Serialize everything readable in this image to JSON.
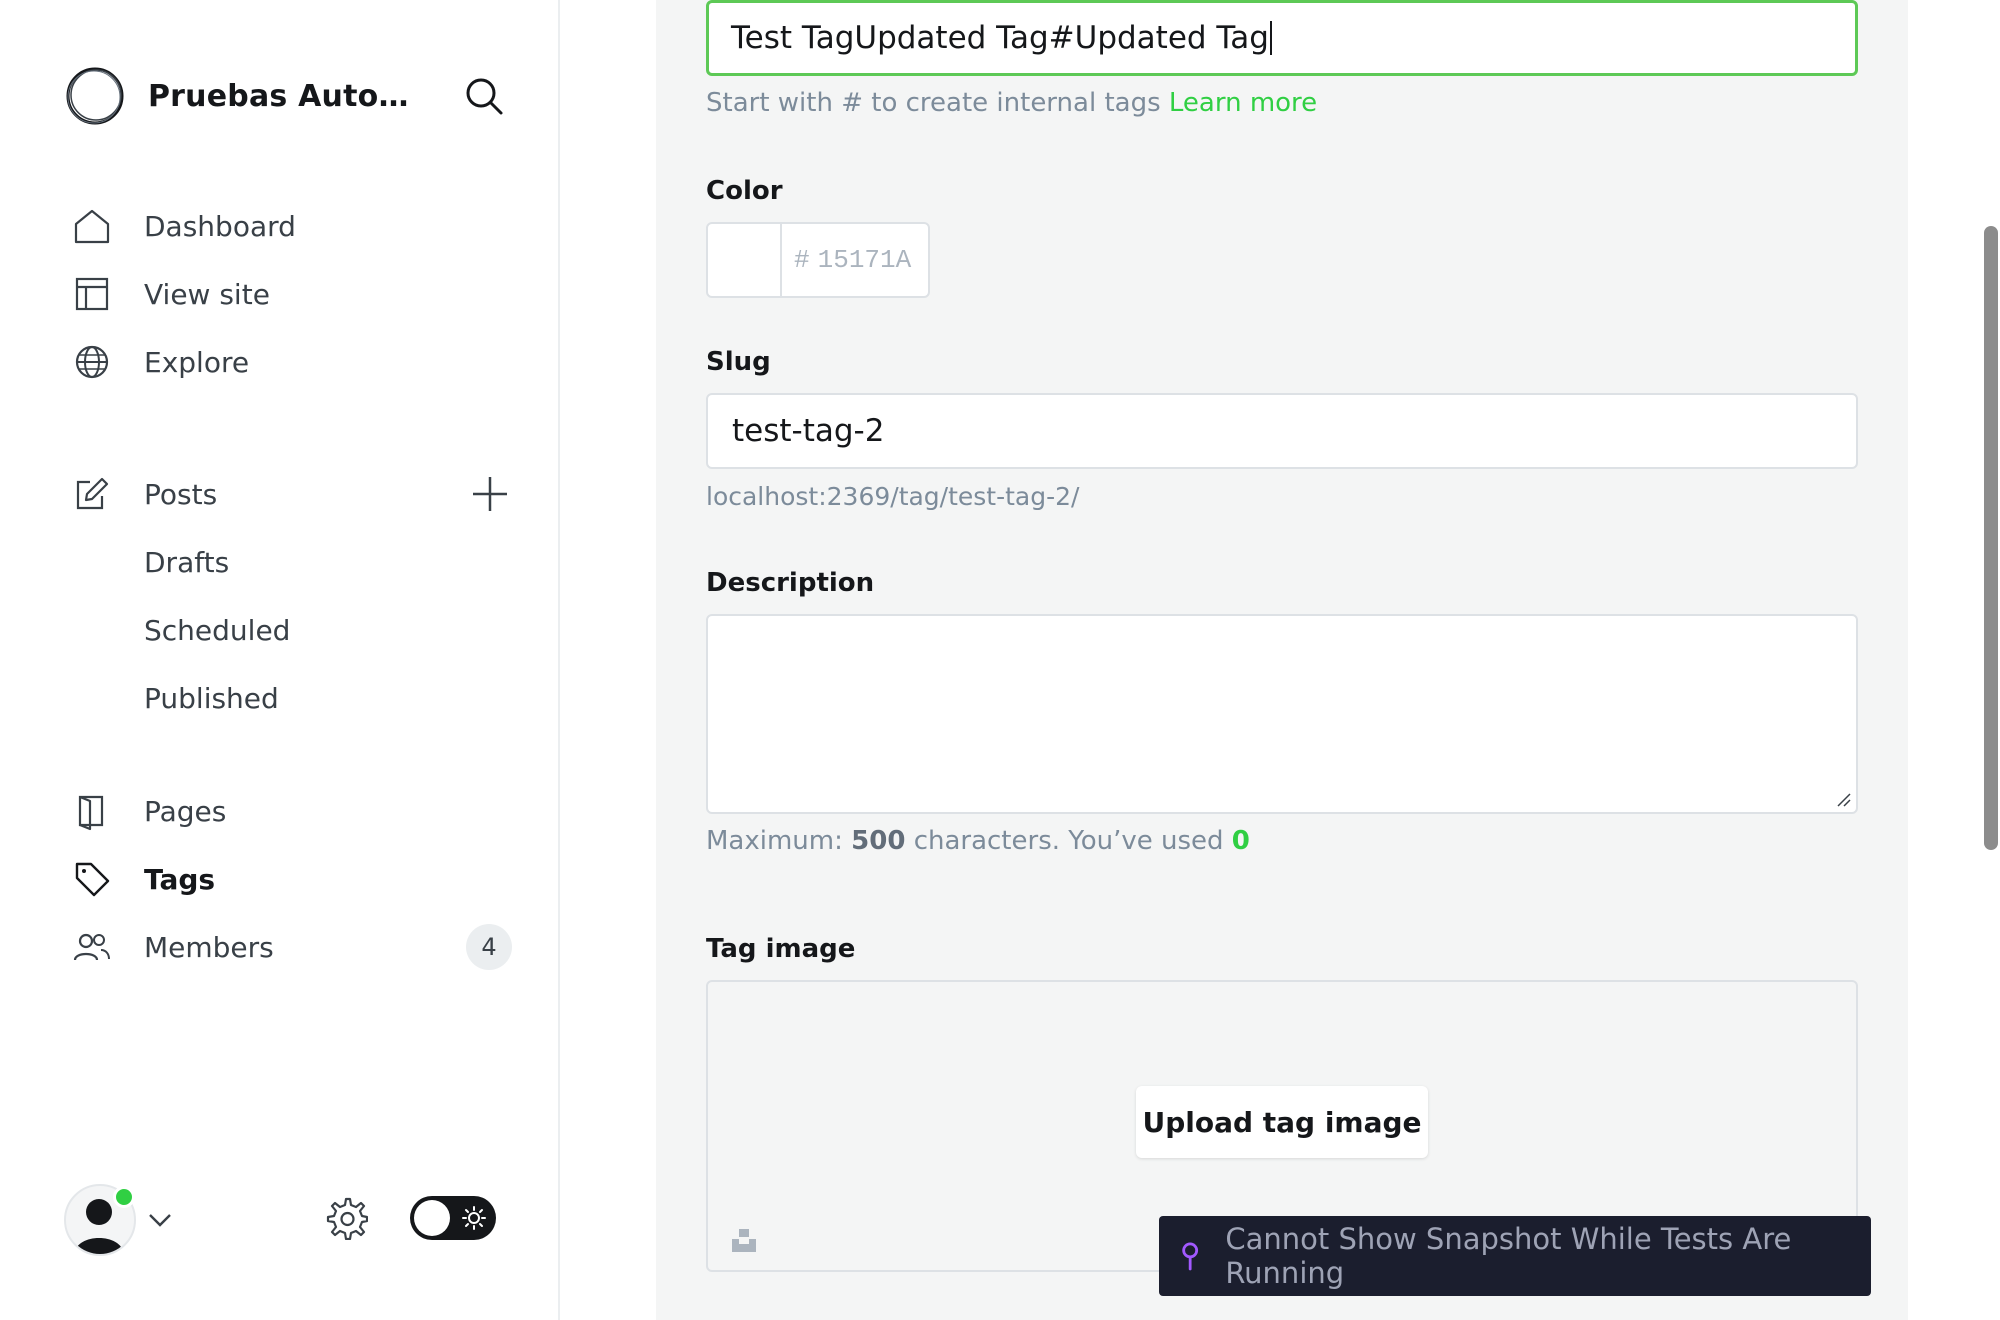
{
  "sidebar": {
    "site_title": "Pruebas Automa...",
    "nav": {
      "dashboard": "Dashboard",
      "view_site": "View site",
      "explore": "Explore",
      "posts": "Posts",
      "drafts": "Drafts",
      "scheduled": "Scheduled",
      "published": "Published",
      "pages": "Pages",
      "tags": "Tags",
      "members": "Members",
      "members_count": "4"
    }
  },
  "form": {
    "name_value": "Test TagUpdated Tag#Updated Tag",
    "name_hint": "Start with # to create internal tags",
    "name_hint_link": "Learn more",
    "color_label": "Color",
    "color_hash": "#",
    "color_value": "15171A",
    "slug_label": "Slug",
    "slug_value": "test-tag-2",
    "slug_url": "localhost:2369/tag/test-tag-2/",
    "description_label": "Description",
    "description_value": "",
    "max_prefix": "Maximum:",
    "max_number": "500",
    "max_middle": "characters. You’ve used",
    "used_count": "0",
    "tag_image_label": "Tag image",
    "upload_label": "Upload tag image"
  },
  "banner": {
    "message": "Cannot Show Snapshot While Tests Are Running"
  },
  "colors": {
    "accent_green": "#30cf43",
    "text_dark": "#15171a",
    "banner_bg": "#1b1e2e"
  }
}
